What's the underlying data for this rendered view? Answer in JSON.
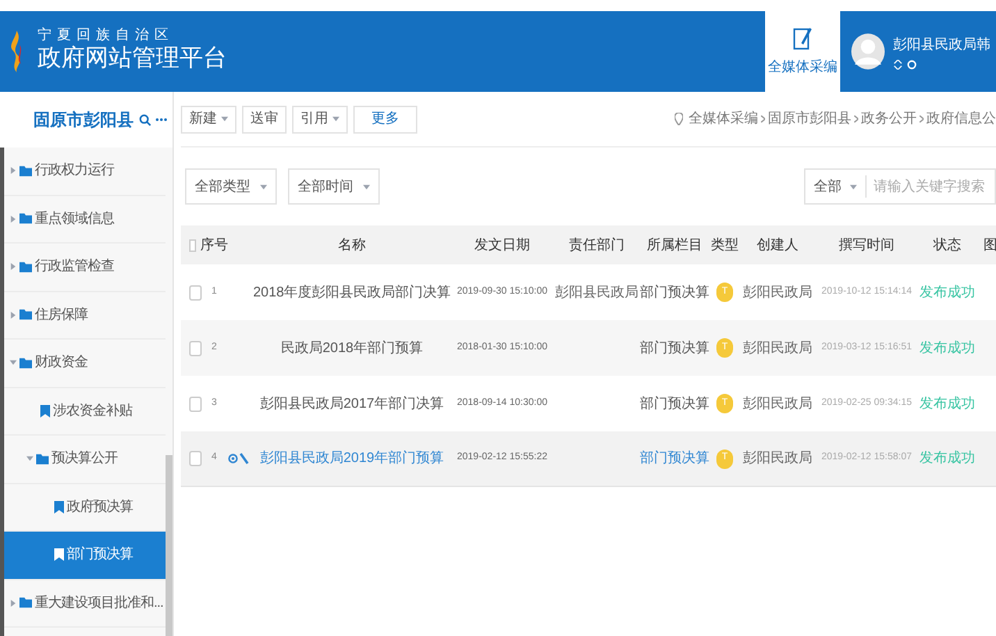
{
  "header": {
    "region": "宁夏回族自治区",
    "title": "政府网站管理平台",
    "tab": {
      "label": "全媒体采编",
      "selected": true
    },
    "user": {
      "name": "彭阳县民政局韩"
    }
  },
  "sidebar": {
    "title": "固原市彭阳县",
    "items": [
      {
        "label": "行政权力运行",
        "kind": "folder",
        "expanded": false,
        "selected": false
      },
      {
        "label": "重点领域信息",
        "kind": "folder",
        "expanded": false,
        "selected": false
      },
      {
        "label": "行政监管检查",
        "kind": "folder",
        "expanded": false,
        "selected": false
      },
      {
        "label": "住房保障",
        "kind": "folder",
        "expanded": false,
        "selected": false
      },
      {
        "label": "财政资金",
        "kind": "folder",
        "expanded": true,
        "selected": false,
        "children": [
          {
            "label": "涉农资金补贴",
            "kind": "page",
            "selected": false
          },
          {
            "label": "预决算公开",
            "kind": "folder",
            "expanded": true,
            "selected": false,
            "children": [
              {
                "label": "政府预决算",
                "kind": "page",
                "selected": false
              },
              {
                "label": "部门预决算",
                "kind": "page",
                "selected": true
              }
            ]
          }
        ]
      },
      {
        "label": "重大建设项目批准和...",
        "kind": "folder",
        "expanded": false,
        "selected": false
      }
    ]
  },
  "toolbar": [
    {
      "label": "新建",
      "dropdown": true
    },
    {
      "label": "送审",
      "dropdown": false
    },
    {
      "label": "引用",
      "dropdown": true
    },
    {
      "label": "更多",
      "dropdown": false
    }
  ],
  "breadcrumb": [
    "全媒体采编",
    "固原市彭阳县",
    "政务公开",
    "政府信息公"
  ],
  "filters": [
    {
      "label": "全部类型"
    },
    {
      "label": "全部时间"
    }
  ],
  "search": {
    "scope": "全部",
    "placeholder": "请输入关键字搜索"
  },
  "table": {
    "all_checked": false,
    "columns": [
      "序号",
      "名称",
      "发文日期",
      "责任部门",
      "所属栏目",
      "类型",
      "创建人",
      "撰写时间",
      "状态",
      "图"
    ],
    "rows": [
      {
        "no": "1",
        "name": "2018年度彭阳县民政局部门决算",
        "date": "2019-09-30 15:10:00",
        "dept": "彭阳县民政局",
        "column": "部门预决算",
        "type": "T",
        "creator": "彭阳民政局",
        "written": "2019-10-12 15:14:14",
        "status": "发布成功",
        "checked": false,
        "selected": false
      },
      {
        "no": "2",
        "name": "民政局2018年部门预算",
        "date": "2018-01-30 15:10:00",
        "column": "部门预决算",
        "type": "T",
        "creator": "彭阳民政局",
        "written": "2019-03-12 15:16:51",
        "status": "发布成功",
        "checked": false,
        "selected": false
      },
      {
        "no": "3",
        "name": "彭阳县民政局2017年部门决算",
        "date": "2018-09-14 10:30:00",
        "column": "部门预决算",
        "type": "T",
        "creator": "彭阳民政局",
        "written": "2019-02-25 09:34:15",
        "status": "发布成功",
        "checked": false,
        "selected": false
      },
      {
        "no": "4",
        "name": "彭阳县民政局2019年部门预算",
        "date": "2019-02-12 15:55:22",
        "column": "部门预决算",
        "type": "T",
        "creator": "彭阳民政局",
        "written": "2019-02-12 15:58:07",
        "status": "发布成功",
        "checked": false,
        "selected": true
      }
    ]
  }
}
